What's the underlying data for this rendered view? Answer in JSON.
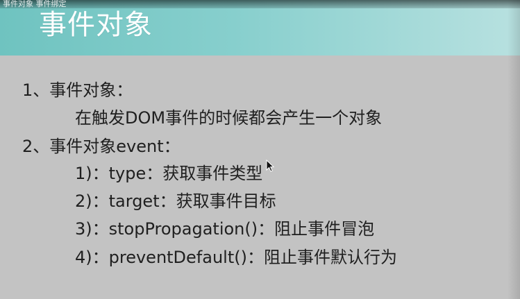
{
  "video_overlay": {
    "top_text": "事件对象 事件绑定"
  },
  "slide": {
    "title": "事件对象",
    "lines": [
      "1、事件对象：",
      "在触发DOM事件的时候都会产生一个对象",
      "2、事件对象event：",
      "1)：type：获取事件类型",
      "2)：target：获取事件目标",
      "3)：stopPropagation()：阻止事件冒泡",
      "4)：preventDefault()：阻止事件默认行为"
    ]
  },
  "icons": {
    "cursor": "mouse-pointer-icon"
  },
  "colors": {
    "header_start": "#6fc3c0",
    "header_end": "#b8e1e0",
    "content_bg": "#c3c3c3",
    "text": "#1f1f1f",
    "title": "#ffffff"
  }
}
